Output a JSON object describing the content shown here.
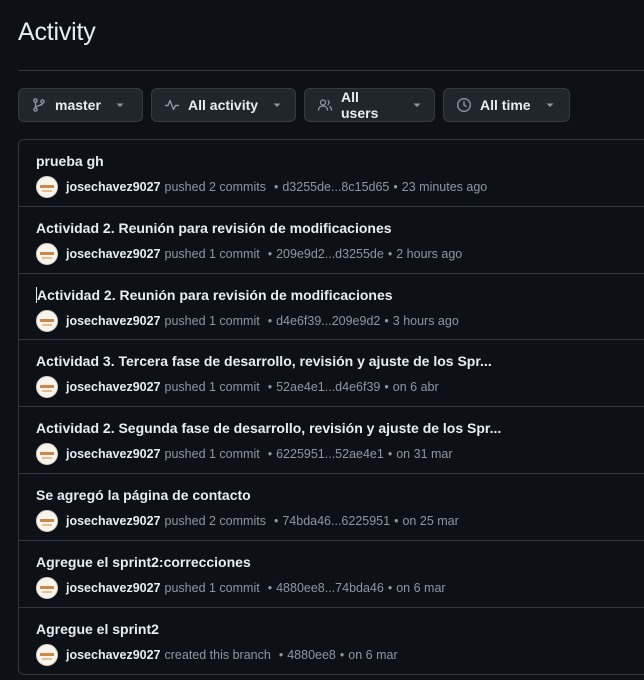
{
  "page": {
    "title": "Activity"
  },
  "filters": {
    "branch": {
      "label": "master",
      "icon": "git-branch-icon"
    },
    "activity": {
      "label": "All activity",
      "icon": "pulse-icon"
    },
    "users": {
      "label": "All users",
      "icon": "people-icon"
    },
    "time": {
      "label": "All time",
      "icon": "clock-icon"
    }
  },
  "activity": [
    {
      "title": "prueba gh",
      "user": "josechavez9027",
      "action": "pushed 2 commits",
      "range": "d3255de...8c15d65",
      "time": "23 minutes ago"
    },
    {
      "title": "Actividad 2. Reunión para revisión de modificaciones",
      "user": "josechavez9027",
      "action": "pushed 1 commit",
      "range": "209e9d2...d3255de",
      "time": "2 hours ago"
    },
    {
      "title": "Actividad 2. Reunión para revisión de modificaciones",
      "user": "josechavez9027",
      "action": "pushed 1 commit",
      "range": "d4e6f39...209e9d2",
      "time": "3 hours ago"
    },
    {
      "title": "Actividad 3. Tercera fase de desarrollo, revisión y ajuste de los Spr...",
      "user": "josechavez9027",
      "action": "pushed 1 commit",
      "range": "52ae4e1...d4e6f39",
      "time": "on 6 abr"
    },
    {
      "title": "Actividad 2. Segunda fase de desarrollo, revisión y ajuste de los Spr...",
      "user": "josechavez9027",
      "action": "pushed 1 commit",
      "range": "6225951...52ae4e1",
      "time": "on 31 mar"
    },
    {
      "title": "Se agregó la página de contacto",
      "user": "josechavez9027",
      "action": "pushed 2 commits",
      "range": "74bda46...6225951",
      "time": "on 25 mar"
    },
    {
      "title": "Agregue el sprint2:correcciones",
      "user": "josechavez9027",
      "action": "pushed 1 commit",
      "range": "4880ee8...74bda46",
      "time": "on 6 mar"
    },
    {
      "title": "Agregue el sprint2",
      "user": "josechavez9027",
      "action": "created this branch",
      "range": "4880ee8",
      "time": "on 6 mar"
    }
  ],
  "colors": {
    "background": "#0d1117",
    "button": "#21262d",
    "border": "#30363d",
    "muted": "#8d96a0",
    "text": "#e6edf3"
  }
}
